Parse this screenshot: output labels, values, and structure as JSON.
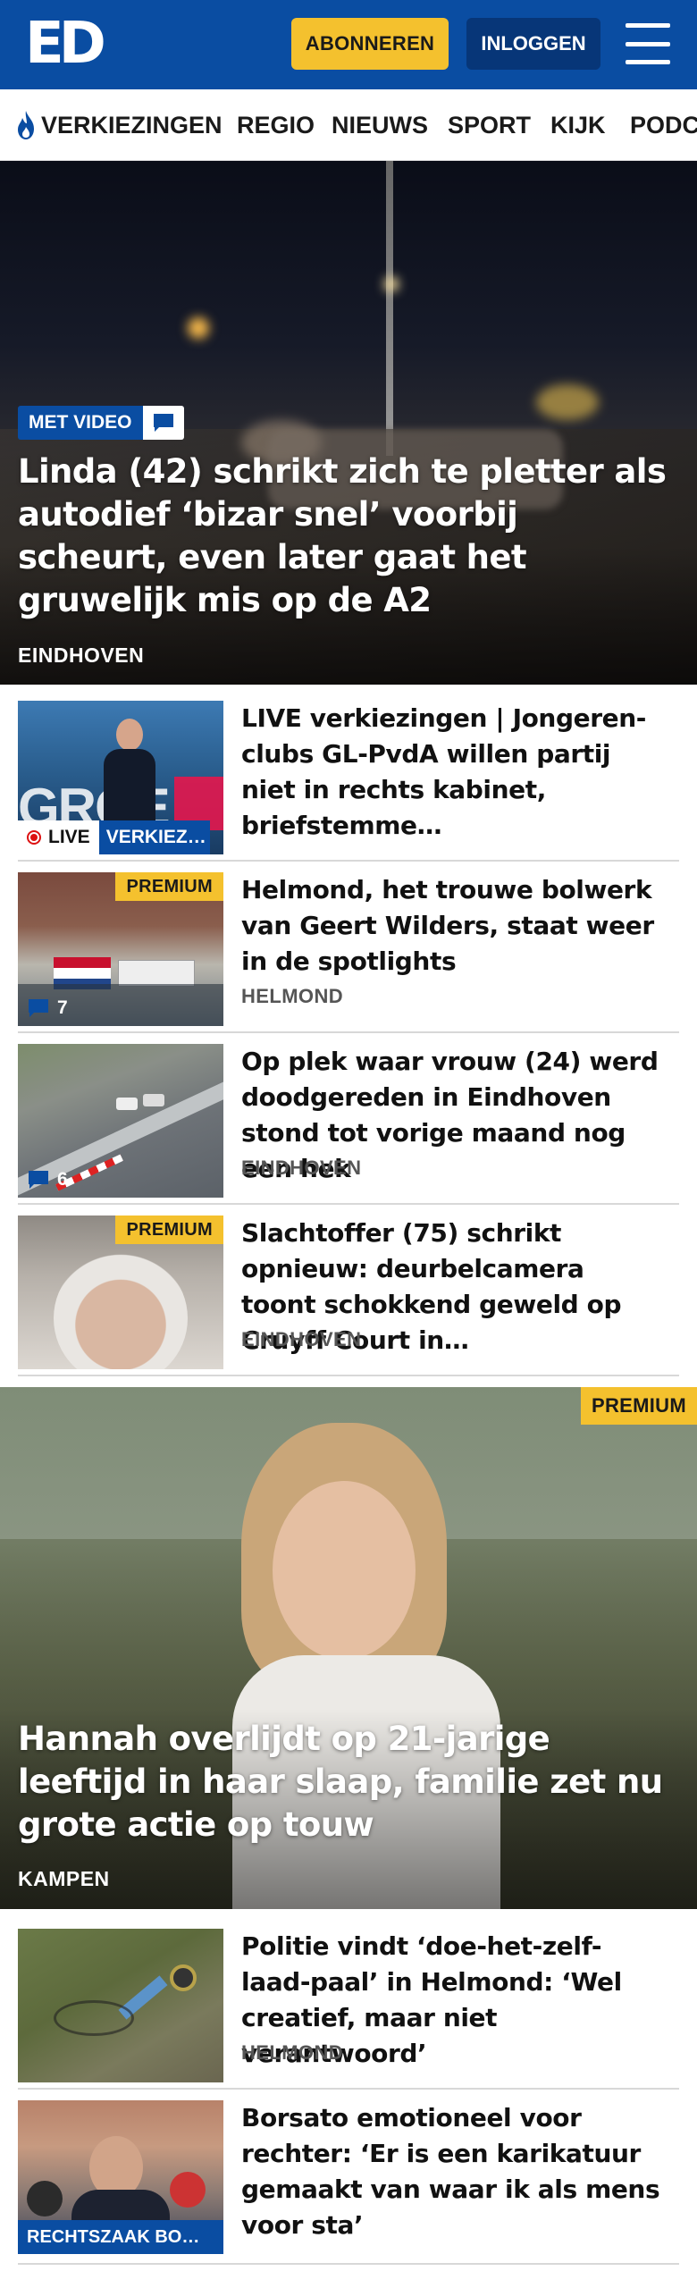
{
  "header": {
    "logo": "ED",
    "subscribe_label": "ABONNEREN",
    "login_label": "INLOGGEN",
    "brand_color": "#0a4da2",
    "accent_color": "#f4c12e"
  },
  "nav": {
    "items": [
      {
        "label": "VERKIEZINGEN",
        "icon": "flame-icon"
      },
      {
        "label": "REGIO"
      },
      {
        "label": "NIEUWS"
      },
      {
        "label": "SPORT"
      },
      {
        "label": "KIJK"
      },
      {
        "label": "PODC"
      }
    ]
  },
  "hero1": {
    "badge": "MET VIDEO",
    "title": "Linda (42) schrikt zich te pletter als autodief ‘bizar snel’ voorbij scheurt, even later gaat het gruwelijk mis op de A2",
    "location": "EINDHOVEN"
  },
  "articles": [
    {
      "title": "LIVE verkiezingen | Jongeren-clubs GL-PvdA willen partij niet in rechts kabinet, briefstemme…",
      "live_label": "LIVE",
      "category": "VERKIEZ…"
    },
    {
      "title": "Helmond, het trouwe bolwerk van Geert Wilders, staat weer in de spotlights",
      "location": "HELMOND",
      "premium": "PREMIUM",
      "comments": "7"
    },
    {
      "title": "Op plek waar vrouw (24) werd doodgereden in Eindhoven stond tot vorige maand nog een hek",
      "location": "EINDHOVEN",
      "comments": "6"
    },
    {
      "title": "Slachtoffer (75) schrikt opnieuw: deurbelcamera toont schokkend geweld op Cruyff Court in…",
      "location": "EINDHOVEN",
      "premium": "PREMIUM"
    }
  ],
  "hero2": {
    "premium": "PREMIUM",
    "title": "Hannah overlijdt op 21-jarige leeftijd in haar slaap, familie zet nu grote actie op touw",
    "location": "KAMPEN"
  },
  "articles2": [
    {
      "title": "Politie vindt ‘doe-het-zelf-laad-paal’ in Helmond: ‘Wel creatief, maar niet verantwoord’",
      "location": "HELMOND"
    },
    {
      "title": "Borsato emotioneel voor rechter: ‘Er is een karikatuur gemaakt van waar ik als mens voor sta’",
      "category": "RECHTSZAAK BO…"
    }
  ]
}
